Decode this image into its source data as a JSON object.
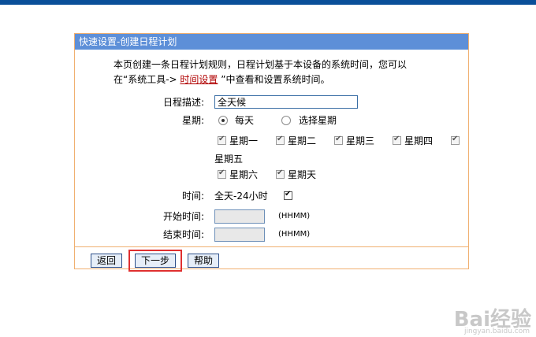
{
  "header": {
    "title": "快速设置-创建日程计划"
  },
  "intro": {
    "line1": "本页创建一条日程计划规则，日程计划基于本设备的系统时间，您可以",
    "line2_pre": "在“系统工具-> ",
    "line2_link": "时间设置",
    "line2_post": " ”中查看和设置系统时间。"
  },
  "form": {
    "desc_label": "日程描述:",
    "desc_value": "全天候",
    "week_label": "星期:",
    "radio_everyday": "每天",
    "radio_select": "选择星期",
    "days": [
      "星期一",
      "星期二",
      "星期三",
      "星期四",
      "星期五",
      "星期六",
      "星期天"
    ],
    "time_label": "时间:",
    "allday_label": "全天-24小时",
    "start_label": "开始时间:",
    "end_label": "结束时间:",
    "hint": "(HHMM)"
  },
  "buttons": {
    "back": "返回",
    "next": "下一步",
    "help": "帮助"
  },
  "watermark": {
    "main": "Bai经验",
    "sub": "jingyan.baidu.com"
  }
}
